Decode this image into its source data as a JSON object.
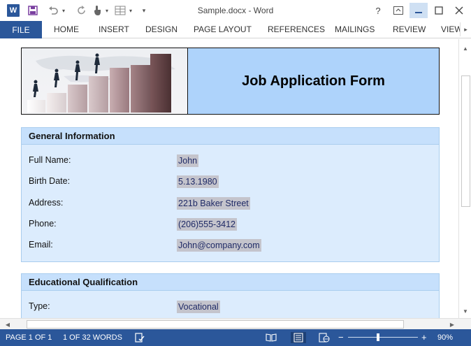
{
  "window": {
    "title": "Sample.docx - Word",
    "app_icon_letter": "W",
    "quick_access": {
      "save_icon": "save-icon",
      "undo_icon": "undo-icon",
      "redo_icon": "redo-icon",
      "touch_icon": "touch-mode-icon",
      "table_icon": "insert-table-icon",
      "customize_icon": "customize-qat-icon"
    },
    "controls": {
      "help": "?",
      "ribbon_options_icon": "ribbon-display-options-icon",
      "minimize_icon": "minimize-icon",
      "maximize_icon": "maximize-icon",
      "close_icon": "close-icon"
    }
  },
  "ribbon": {
    "file_label": "FILE",
    "tabs": [
      "HOME",
      "INSERT",
      "DESIGN",
      "PAGE LAYOUT",
      "REFERENCES",
      "MAILINGS",
      "REVIEW",
      "VIEW"
    ]
  },
  "document": {
    "form_title": "Job Application Form",
    "sections": [
      {
        "heading": "General Information",
        "fields": [
          {
            "label": "Full Name:",
            "value": "John"
          },
          {
            "label": "Birth Date:",
            "value": "5.13.1980"
          },
          {
            "label": "Address:",
            "value": "221b Baker Street"
          },
          {
            "label": "Phone:",
            "value": "(206)555-3412"
          },
          {
            "label": "Email:",
            "value": "John@company.com"
          }
        ]
      },
      {
        "heading": "Educational Qualification",
        "fields": [
          {
            "label": "Type:",
            "value": "Vocational"
          }
        ]
      }
    ]
  },
  "status_bar": {
    "page": "PAGE 1 OF 1",
    "words": "1 OF 32 WORDS",
    "proofing_icon": "proofing-icon",
    "view_icons": [
      "read-mode-icon",
      "print-layout-icon",
      "web-layout-icon"
    ],
    "zoom_out": "−",
    "zoom_in": "+",
    "zoom_level": "90%",
    "zoom_fraction": 0.43
  },
  "colors": {
    "brand": "#2b579a",
    "title_cell": "#aed3fb",
    "section_head": "#c6e0fc",
    "section_body": "#dcecfd",
    "field_highlight": "#c4c4cc"
  }
}
